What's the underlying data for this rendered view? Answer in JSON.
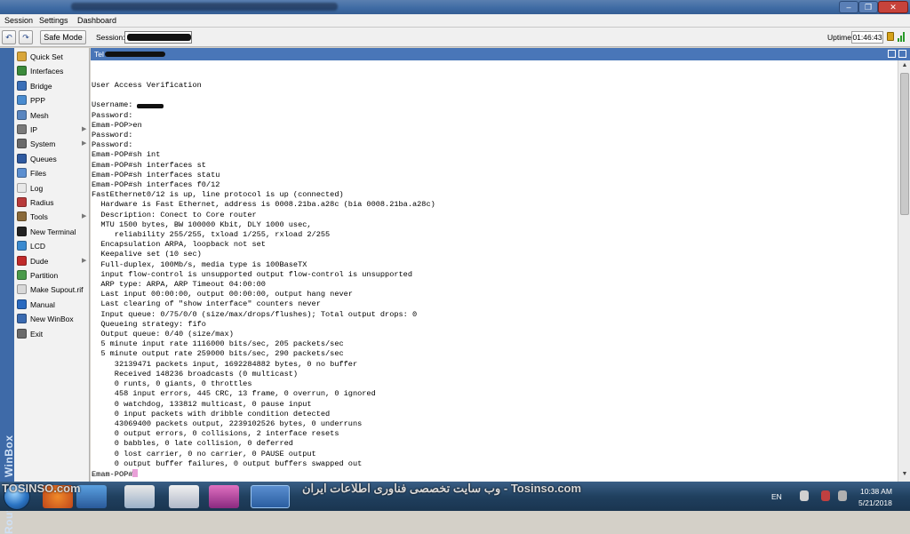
{
  "menubar": {
    "items": [
      "Session",
      "Settings",
      "Dashboard"
    ]
  },
  "toolbar": {
    "safe_mode_label": "Safe Mode",
    "session_label": "Session:",
    "uptime_label": "Uptime:",
    "uptime_value": "01:46:43"
  },
  "brand": {
    "vertical_text": "RouterOS WinBox"
  },
  "sidebar": {
    "items": [
      {
        "label": "Quick Set",
        "icon": "quick-set-icon",
        "color": "#d9a63a",
        "submenu": false
      },
      {
        "label": "Interfaces",
        "icon": "interfaces-icon",
        "color": "#3b8a3b",
        "submenu": false
      },
      {
        "label": "Bridge",
        "icon": "bridge-icon",
        "color": "#3a6fb8",
        "submenu": false
      },
      {
        "label": "PPP",
        "icon": "ppp-icon",
        "color": "#4a8cd0",
        "submenu": false
      },
      {
        "label": "Mesh",
        "icon": "mesh-icon",
        "color": "#5a86c0",
        "submenu": false
      },
      {
        "label": "IP",
        "icon": "ip-icon",
        "color": "#7a7a7a",
        "submenu": true
      },
      {
        "label": "System",
        "icon": "system-icon",
        "color": "#6a6a6a",
        "submenu": true
      },
      {
        "label": "Queues",
        "icon": "queues-icon",
        "color": "#2f5aa0",
        "submenu": false
      },
      {
        "label": "Files",
        "icon": "files-icon",
        "color": "#5c8fd0",
        "submenu": false
      },
      {
        "label": "Log",
        "icon": "log-icon",
        "color": "#e8e8e8",
        "submenu": false
      },
      {
        "label": "Radius",
        "icon": "radius-icon",
        "color": "#b83a3a",
        "submenu": false
      },
      {
        "label": "Tools",
        "icon": "tools-icon",
        "color": "#8a6a3a",
        "submenu": true
      },
      {
        "label": "New Terminal",
        "icon": "terminal-icon",
        "color": "#222222",
        "submenu": false
      },
      {
        "label": "LCD",
        "icon": "lcd-icon",
        "color": "#3a8ad0",
        "submenu": false
      },
      {
        "label": "Dude",
        "icon": "dude-icon",
        "color": "#c02a2a",
        "submenu": true
      },
      {
        "label": "Partition",
        "icon": "partition-icon",
        "color": "#4a9a4a",
        "submenu": false
      },
      {
        "label": "Make Supout.rif",
        "icon": "supout-icon",
        "color": "#d8d8d8",
        "submenu": false
      },
      {
        "label": "Manual",
        "icon": "manual-icon",
        "color": "#2a6ac0",
        "submenu": false
      },
      {
        "label": "New WinBox",
        "icon": "winbox-icon",
        "color": "#3a6ab0",
        "submenu": false
      },
      {
        "label": "Exit",
        "icon": "exit-icon",
        "color": "#6a6a6a",
        "submenu": false
      }
    ]
  },
  "terminal": {
    "title": "Tel",
    "lines": [
      "User Access Verification",
      "",
      "Username: ",
      "Password:",
      "Emam-POP>en",
      "Password:",
      "Password:",
      "Emam-POP#sh int",
      "Emam-POP#sh interfaces st",
      "Emam-POP#sh interfaces statu",
      "Emam-POP#sh interfaces f0/12",
      "FastEthernet0/12 is up, line protocol is up (connected)",
      "  Hardware is Fast Ethernet, address is 0008.21ba.a28c (bia 0008.21ba.a28c)",
      "  Description: Conect to Core router",
      "  MTU 1500 bytes, BW 100000 Kbit, DLY 1000 usec,",
      "     reliability 255/255, txload 1/255, rxload 2/255",
      "  Encapsulation ARPA, loopback not set",
      "  Keepalive set (10 sec)",
      "  Full-duplex, 100Mb/s, media type is 100BaseTX",
      "  input flow-control is unsupported output flow-control is unsupported",
      "  ARP type: ARPA, ARP Timeout 04:00:00",
      "  Last input 00:00:00, output 00:00:00, output hang never",
      "  Last clearing of \"show interface\" counters never",
      "  Input queue: 0/75/0/0 (size/max/drops/flushes); Total output drops: 0",
      "  Queueing strategy: fifo",
      "  Output queue: 0/40 (size/max)",
      "  5 minute input rate 1116000 bits/sec, 205 packets/sec",
      "  5 minute output rate 259000 bits/sec, 290 packets/sec",
      "     32139471 packets input, 1692284882 bytes, 0 no buffer",
      "     Received 148236 broadcasts (0 multicast)",
      "     0 runts, 0 giants, 0 throttles",
      "     458 input errors, 445 CRC, 13 frame, 0 overrun, 0 ignored",
      "     0 watchdog, 133812 multicast, 0 pause input",
      "     0 input packets with dribble condition detected",
      "     43069400 packets output, 2239102526 bytes, 0 underruns",
      "     0 output errors, 0 collisions, 2 interface resets",
      "     0 babbles, 0 late collision, 0 deferred",
      "     0 lost carrier, 0 no carrier, 0 PAUSE output",
      "     0 output buffer failures, 0 output buffers swapped out"
    ],
    "prompt": "Emam-POP#"
  },
  "taskbar": {
    "watermark_left": "TOSINSO.com",
    "watermark_right": "وب سایت تخصصی فناوری اطلاعات ایران - Tosinso.com",
    "language": "EN",
    "time": "10:38 AM",
    "date": "5/21/2018"
  },
  "colors": {
    "title_blue": "#3d6aa3",
    "terminal_header": "#4976b8",
    "brand_strip": "#3e6aa8",
    "cursor": "#e9a0d8"
  }
}
